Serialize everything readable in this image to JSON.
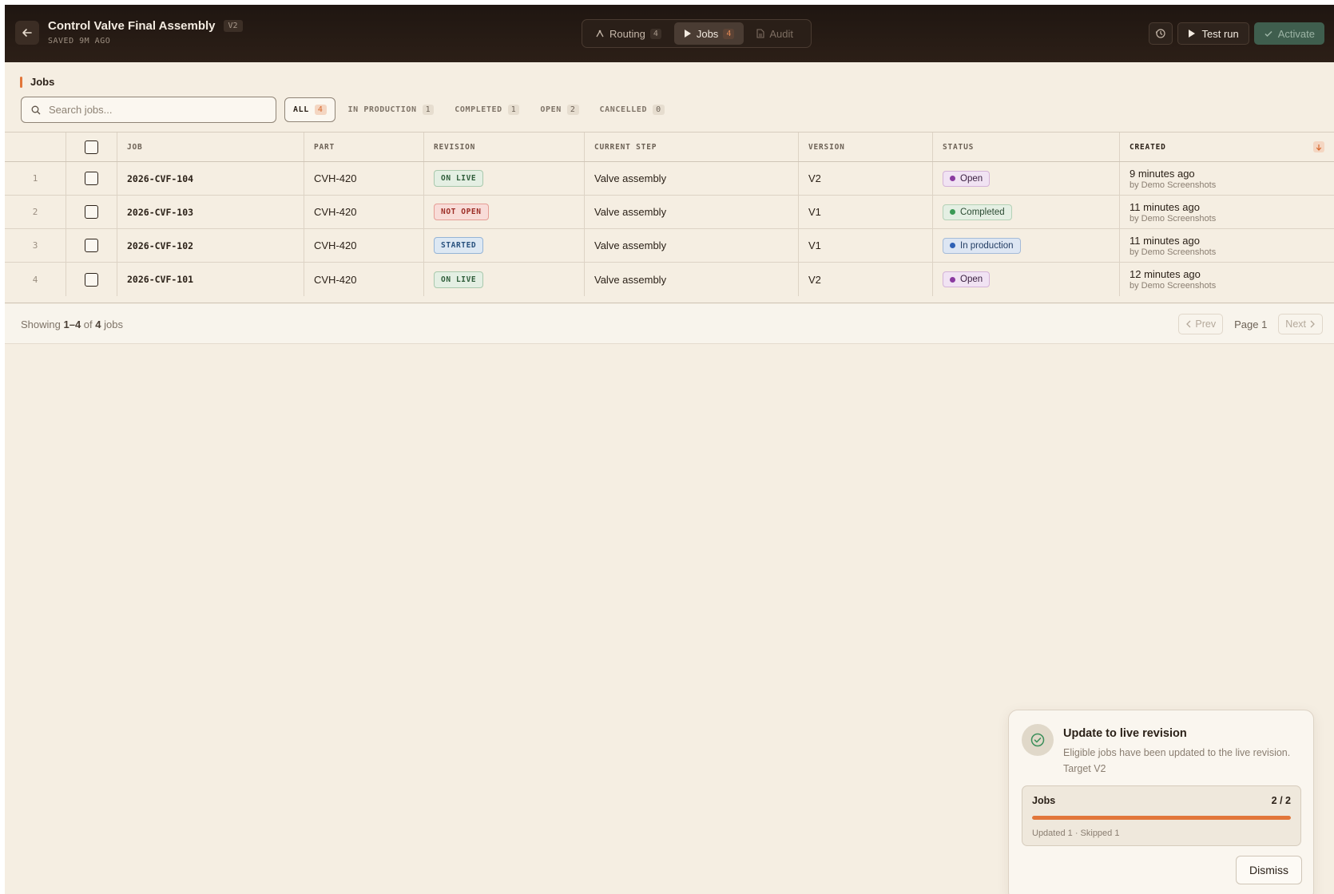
{
  "header": {
    "title": "Control Valve Final Assembly",
    "version_badge": "V2",
    "saved_text": "SAVED 9M AGO",
    "tabs": [
      {
        "label": "Routing",
        "count": "4",
        "icon": "routing-icon"
      },
      {
        "label": "Jobs",
        "count": "4",
        "icon": "play-icon"
      },
      {
        "label": "Audit",
        "icon": "document-icon"
      }
    ],
    "test_run_label": "Test run",
    "activate_label": "Activate"
  },
  "section": {
    "title": "Jobs"
  },
  "search": {
    "placeholder": "Search jobs..."
  },
  "filters": [
    {
      "label": "ALL",
      "count": "4"
    },
    {
      "label": "IN PRODUCTION",
      "count": "1"
    },
    {
      "label": "COMPLETED",
      "count": "1"
    },
    {
      "label": "OPEN",
      "count": "2"
    },
    {
      "label": "CANCELLED",
      "count": "0"
    }
  ],
  "table": {
    "columns": [
      "JOB",
      "PART",
      "REVISION",
      "CURRENT STEP",
      "VERSION",
      "STATUS",
      "CREATED"
    ],
    "rows": [
      {
        "num": "1",
        "job": "2026-CVF-104",
        "part": "CVH-420",
        "revision": "ON LIVE",
        "step": "Valve assembly",
        "version": "V2",
        "status": "Open",
        "created": "9 minutes ago",
        "by": "by Demo Screenshots"
      },
      {
        "num": "2",
        "job": "2026-CVF-103",
        "part": "CVH-420",
        "revision": "NOT OPEN",
        "step": "Valve assembly",
        "version": "V1",
        "status": "Completed",
        "created": "11 minutes ago",
        "by": "by Demo Screenshots"
      },
      {
        "num": "3",
        "job": "2026-CVF-102",
        "part": "CVH-420",
        "revision": "STARTED",
        "step": "Valve assembly",
        "version": "V1",
        "status": "In production",
        "created": "11 minutes ago",
        "by": "by Demo Screenshots"
      },
      {
        "num": "4",
        "job": "2026-CVF-101",
        "part": "CVH-420",
        "revision": "ON LIVE",
        "step": "Valve assembly",
        "version": "V2",
        "status": "Open",
        "created": "12 minutes ago",
        "by": "by Demo Screenshots"
      }
    ]
  },
  "footer": {
    "showing_prefix": "Showing ",
    "showing_range": "1–4",
    "showing_of": " of ",
    "showing_total": "4",
    "showing_suffix": " jobs",
    "prev_label": "Prev",
    "page_label": "Page 1",
    "next_label": "Next"
  },
  "toast": {
    "title": "Update to live revision",
    "description": "Eligible jobs have been updated to the live revision. Target V2",
    "progress_label": "Jobs",
    "progress_count": "2 / 2",
    "progress_fraction": 1.0,
    "stats": "Updated 1 · Skipped 1",
    "dismiss_label": "Dismiss"
  },
  "colors": {
    "accent": "#e2763a",
    "header_bg": "#2c1f17",
    "page_bg": "#f5eee2",
    "activate_bg": "#3f5e4e"
  }
}
